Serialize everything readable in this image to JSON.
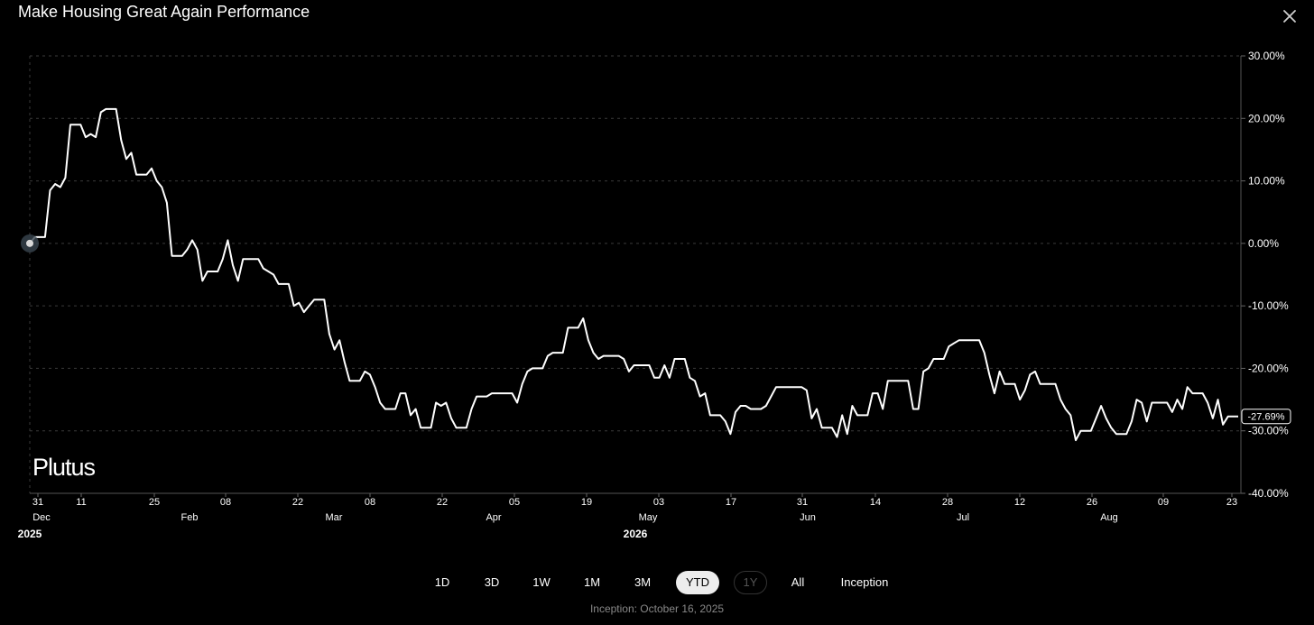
{
  "title": "Make Housing Great Again Performance",
  "close_icon": "close-icon",
  "brand": "Plutus",
  "ranges": [
    "1D",
    "3D",
    "1W",
    "1M",
    "3M",
    "YTD",
    "1Y",
    "All",
    "Inception"
  ],
  "active_range": "YTD",
  "disabled_range": "1Y",
  "inception_text": "Inception: October 16, 2025",
  "colors": {
    "background": "#000000",
    "line": "#ffffff",
    "grid": "#3a3a3a",
    "muted": "#888888"
  },
  "chart_data": {
    "type": "line",
    "title": "Make Housing Great Again Performance",
    "xlabel": "",
    "ylabel": "",
    "ylim": [
      -40,
      30
    ],
    "grid": true,
    "y_axis_position": "right",
    "y_ticks": [
      "30.00%",
      "20.00%",
      "10.00%",
      "0.00%",
      "-10.00%",
      "-20.00%",
      "-30.00%",
      "-40.00%"
    ],
    "y_tick_values": [
      30,
      20,
      10,
      0,
      -10,
      -20,
      -30,
      -40
    ],
    "x_tick_days": [
      "31",
      "11",
      "25",
      "08",
      "22",
      "08",
      "22",
      "05",
      "19",
      "03",
      "17",
      "31",
      "14",
      "28",
      "12",
      "26",
      "09",
      "23"
    ],
    "x_tick_months": [
      "Dec",
      "Feb",
      "Mar",
      "Apr",
      "May",
      "Jun",
      "Jul",
      "Aug"
    ],
    "x_tick_years": [
      "2025",
      "2026"
    ],
    "last_value_label": "-27.69%",
    "series": [
      {
        "values": [
          0,
          1,
          1,
          1,
          8.5,
          9.5,
          9,
          10.5,
          19,
          19,
          19,
          17,
          17.5,
          17,
          21,
          21.5,
          21.5,
          21.5,
          16.5,
          13.5,
          14.5,
          11,
          11,
          11,
          12,
          10,
          9,
          6.5,
          -2,
          -2,
          -2,
          -1,
          0.5,
          -1,
          -6,
          -4.5,
          -4.5,
          -4.5,
          -2.5,
          0.5,
          -3.5,
          -6,
          -2.5,
          -2.5,
          -2.5,
          -2.5,
          -4,
          -4.5,
          -5,
          -6.5,
          -6.5,
          -6.5,
          -10,
          -9.5,
          -11,
          -10,
          -9,
          -9,
          -9,
          -14.5,
          -17,
          -15.5,
          -19,
          -22,
          -22,
          -22,
          -20.5,
          -21,
          -23,
          -25.5,
          -26.5,
          -26.5,
          -26.5,
          -24,
          -24,
          -27.5,
          -26.5,
          -29.5,
          -29.5,
          -29.5,
          -25.5,
          -26,
          -25.5,
          -28,
          -29.5,
          -29.5,
          -29.5,
          -26.5,
          -24.5,
          -24.5,
          -24.5,
          -24,
          -24,
          -24,
          -24,
          -24,
          -25.5,
          -22.5,
          -20.5,
          -20,
          -20,
          -20,
          -18,
          -17.5,
          -17.5,
          -17.5,
          -13.5,
          -13.5,
          -13.5,
          -12,
          -15.5,
          -17.5,
          -18.5,
          -18,
          -18,
          -18,
          -18,
          -18.5,
          -20.5,
          -19.5,
          -19.5,
          -19.5,
          -19.5,
          -21.5,
          -21.5,
          -19.5,
          -21.5,
          -18.5,
          -18.5,
          -18.5,
          -21.5,
          -22,
          -24.5,
          -24,
          -27.5,
          -27.5,
          -27.5,
          -28.5,
          -30.5,
          -27,
          -26,
          -26,
          -26.5,
          -26.5,
          -26.5,
          -26,
          -24.5,
          -23,
          -23,
          -23,
          -23,
          -23,
          -23,
          -23.5,
          -28,
          -26.5,
          -29.5,
          -29.5,
          -29.5,
          -31,
          -27.5,
          -30.5,
          -26,
          -27.5,
          -27.5,
          -27.5,
          -24,
          -24,
          -26.5,
          -22,
          -22,
          -22,
          -22,
          -22,
          -26.5,
          -26.5,
          -20.5,
          -20,
          -18.5,
          -18.5,
          -18.5,
          -16.5,
          -16,
          -15.5,
          -15.5,
          -15.5,
          -15.5,
          -15.5,
          -17.5,
          -21,
          -24,
          -20.5,
          -22.5,
          -22.5,
          -22.5,
          -25,
          -23.5,
          -21,
          -20.5,
          -22.5,
          -22.5,
          -22.5,
          -22.5,
          -25,
          -26.5,
          -27.5,
          -31.5,
          -30,
          -30,
          -30,
          -28,
          -26,
          -28,
          -29.5,
          -30.5,
          -30.5,
          -30.5,
          -28.5,
          -25,
          -25.5,
          -28.5,
          -25.5,
          -25.5,
          -25.5,
          -25.5,
          -27,
          -25,
          -26.5,
          -23,
          -24,
          -24,
          -24,
          -25.5,
          -28,
          -25,
          -29,
          -27.7,
          -27.7,
          -27.69
        ]
      }
    ]
  }
}
